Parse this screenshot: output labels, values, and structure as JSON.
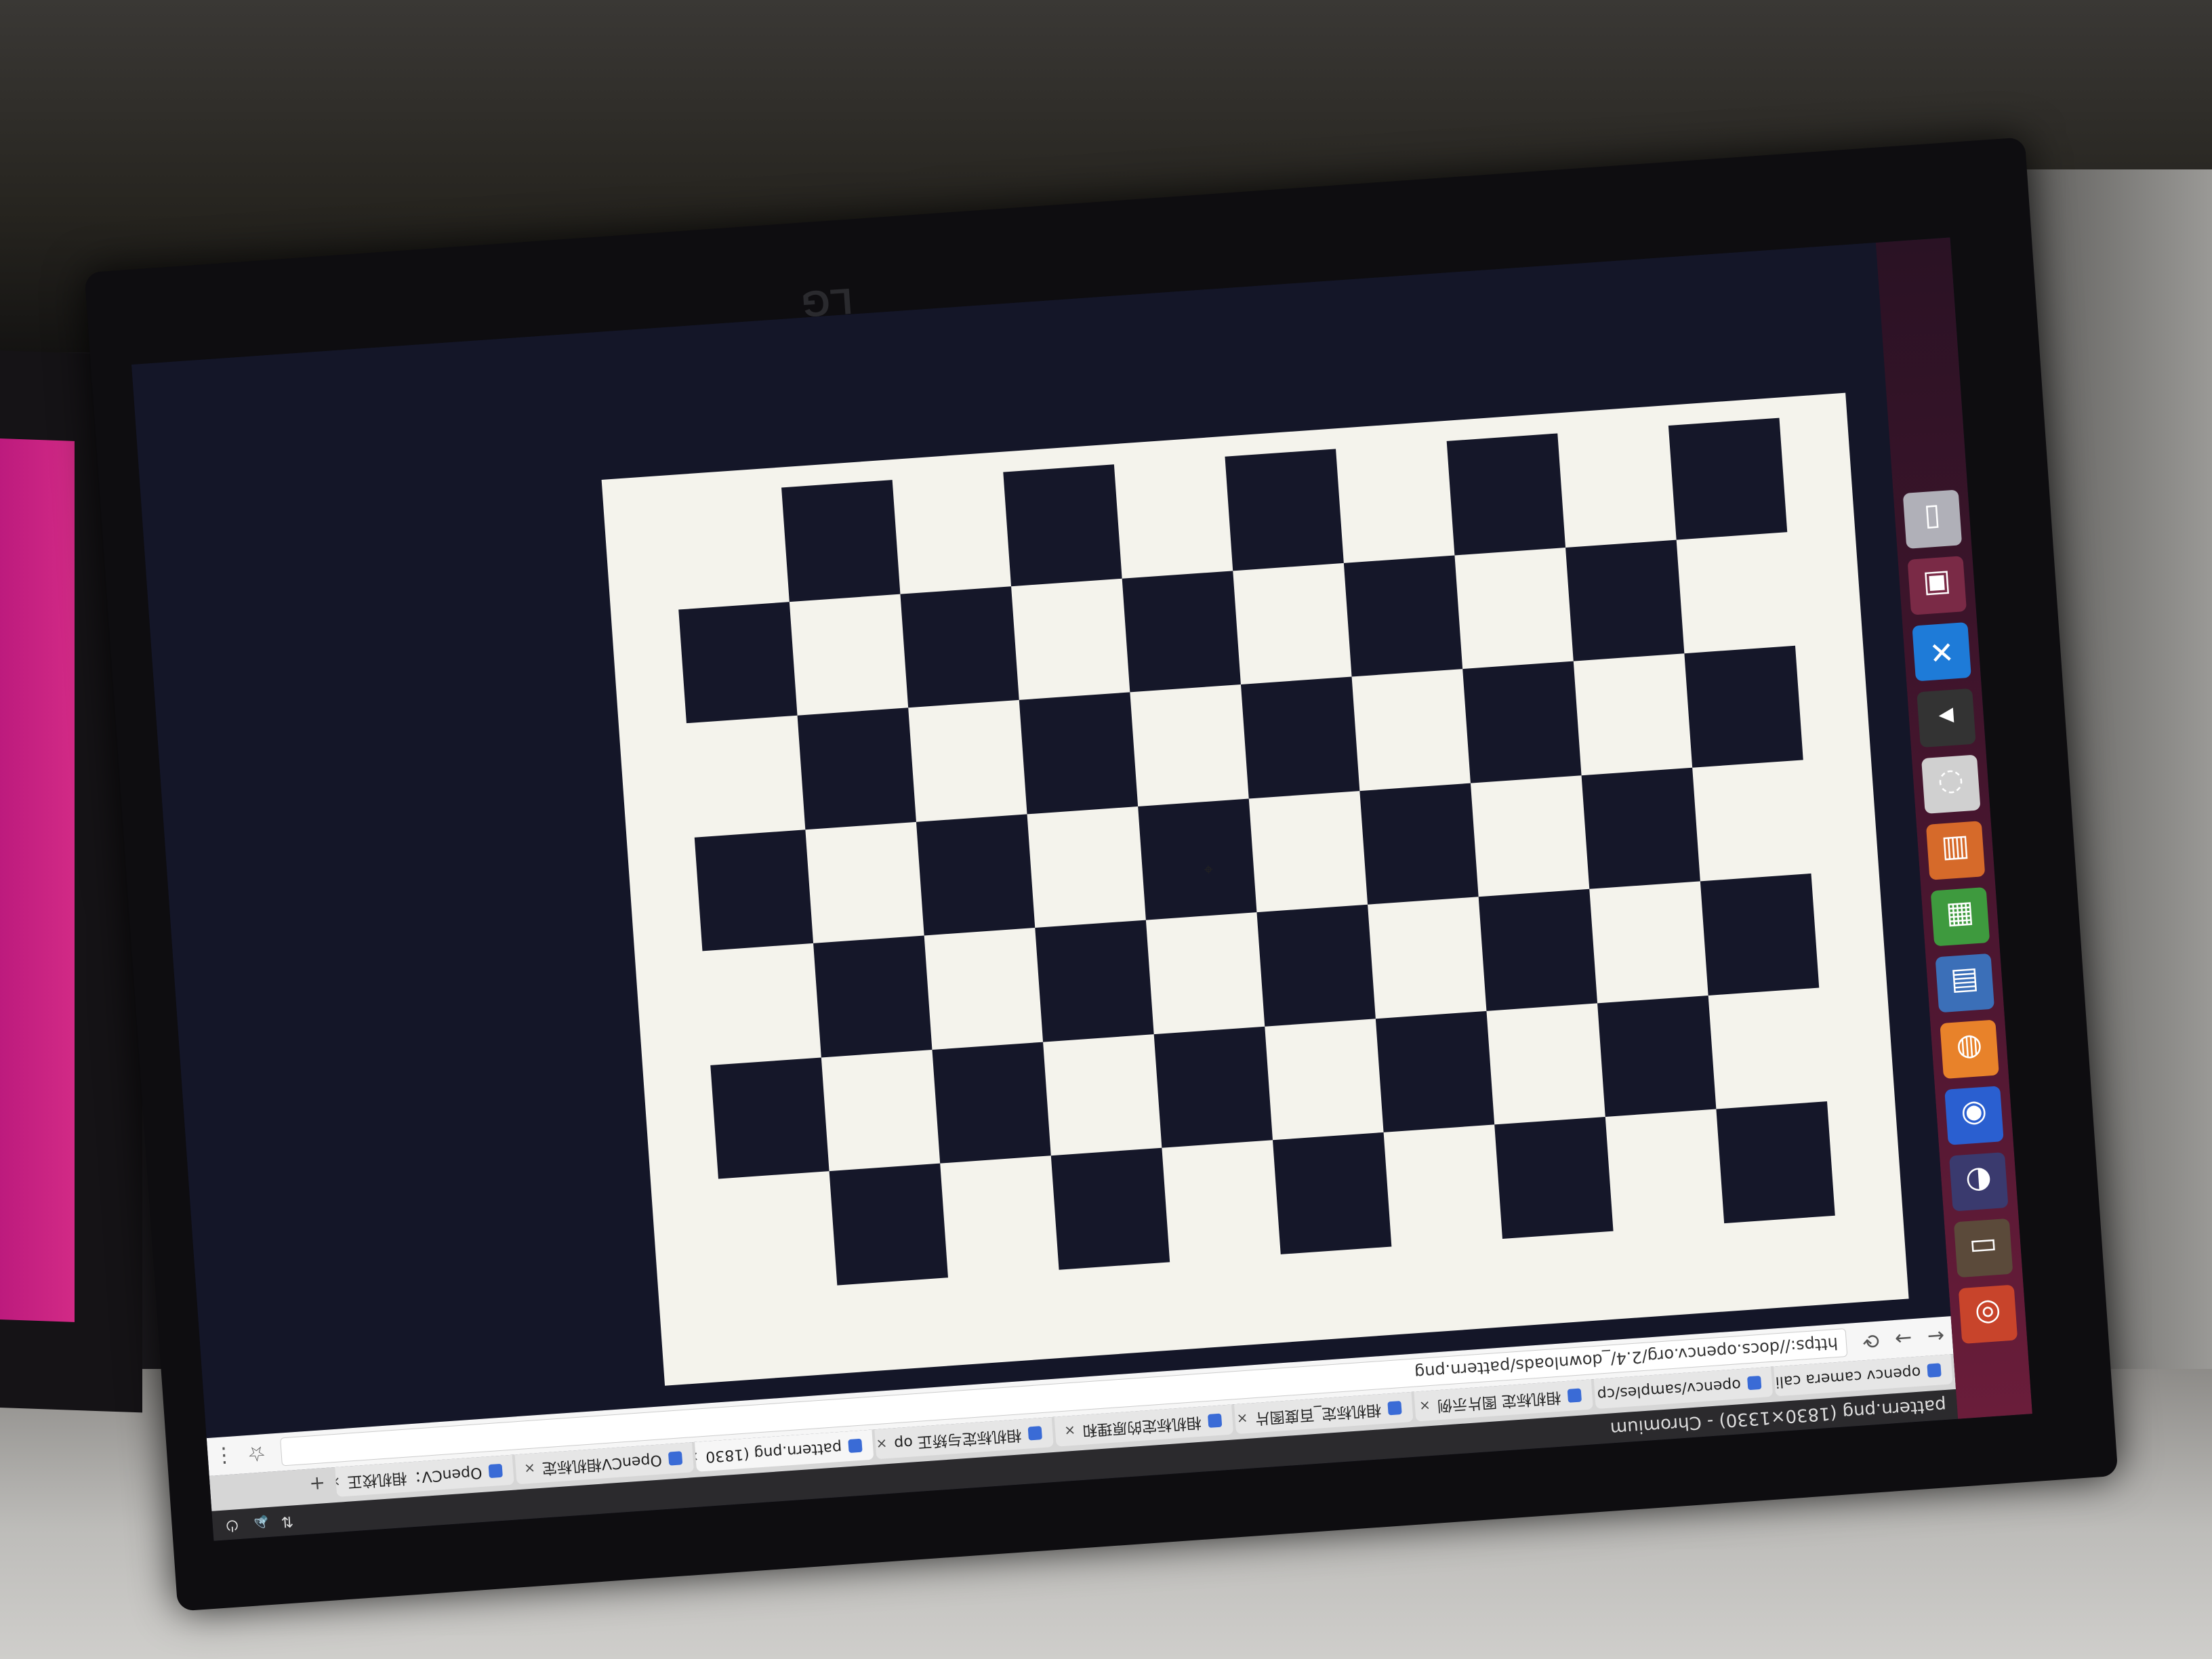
{
  "window": {
    "title": "pattern.png (1830×1330) - Chromium"
  },
  "browser": {
    "tabs": [
      {
        "label": "opencv camera cali",
        "active": false
      },
      {
        "label": "opencv/samples/cp",
        "active": false
      },
      {
        "label": "相机标定 图片示例",
        "active": false
      },
      {
        "label": "相机标定_百度图片",
        "active": false
      },
      {
        "label": "相机标定的原理和",
        "active": false
      },
      {
        "label": "相机标定与矫正 op",
        "active": false
      },
      {
        "label": "pattern.png (1830",
        "active": true
      },
      {
        "label": "OpenCV相机标定",
        "active": false
      },
      {
        "label": "OpenCV：相机校正",
        "active": false
      }
    ],
    "new_tab": "+",
    "url": "https://docs.opencv.org/2.4/_downloads/pattern.png",
    "back_icon": "arrow-left-icon",
    "forward_icon": "arrow-right-icon",
    "reload_icon": "reload-icon",
    "menu_icon": "kebab-menu-icon",
    "star_icon": "star-icon"
  },
  "launcher": {
    "items": [
      "ubuntu-dash-icon",
      "files-icon",
      "disk-icon",
      "chromium-icon",
      "firefox-icon",
      "writer-icon",
      "calc-icon",
      "impress-icon",
      "color-picker-icon",
      "terminal-icon",
      "x-app-icon",
      "workspace-icon",
      "trash-icon"
    ]
  },
  "checkerboard": {
    "rows": 7,
    "cols": 10,
    "dark_color": "#151729",
    "light_color": "#f4f3ec"
  },
  "monitor": {
    "brand": "LG"
  }
}
